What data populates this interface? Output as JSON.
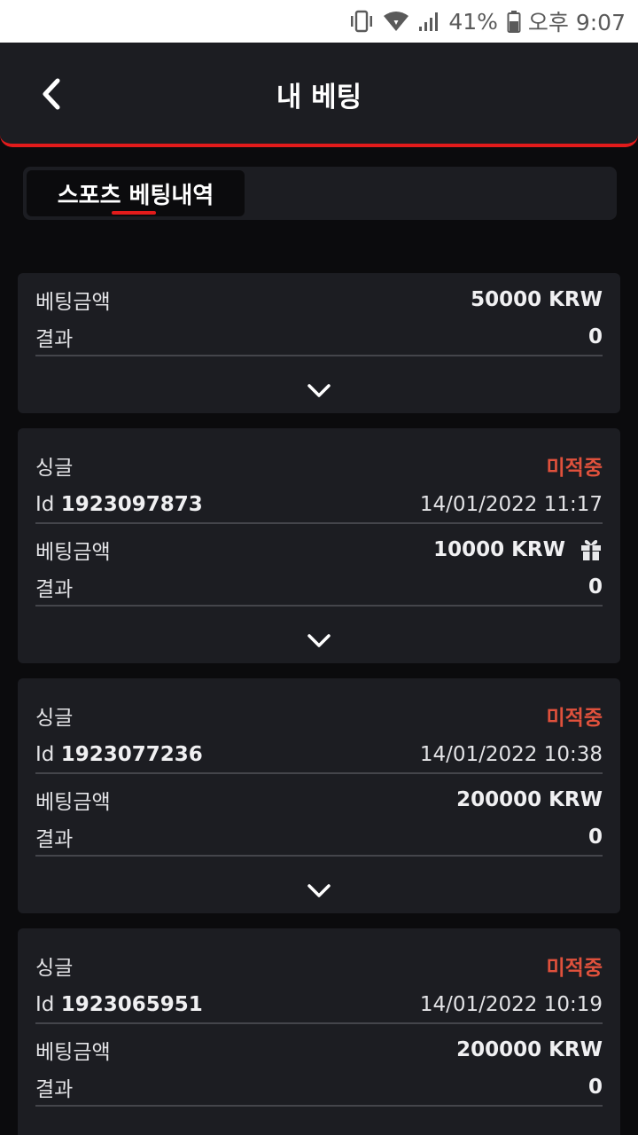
{
  "status_bar": {
    "battery": "41%",
    "time": "오후 9:07"
  },
  "header": {
    "title": "내 베팅"
  },
  "tabs": [
    {
      "label": "스포츠 베팅내역"
    }
  ],
  "labels": {
    "bet_amount": "베팅금액",
    "result": "결과",
    "id_prefix": "Id"
  },
  "bets": [
    {
      "amount": "50000 KRW",
      "result": "0"
    },
    {
      "type": "싱글",
      "status": "미적중",
      "id": "1923097873",
      "date": "14/01/2022 11:17",
      "amount": "10000 KRW",
      "result": "0",
      "gift_icon": "gift-icon"
    },
    {
      "type": "싱글",
      "status": "미적중",
      "id": "1923077236",
      "date": "14/01/2022 10:38",
      "amount": "200000 KRW",
      "result": "0"
    },
    {
      "type": "싱글",
      "status": "미적중",
      "id": "1923065951",
      "date": "14/01/2022 10:19",
      "amount": "200000 KRW",
      "result": "0"
    }
  ],
  "colors": {
    "accent": "#e21b1b",
    "status_miss": "#e0513c",
    "card_bg": "#1c1d22",
    "page_bg": "#0b0b0d"
  }
}
